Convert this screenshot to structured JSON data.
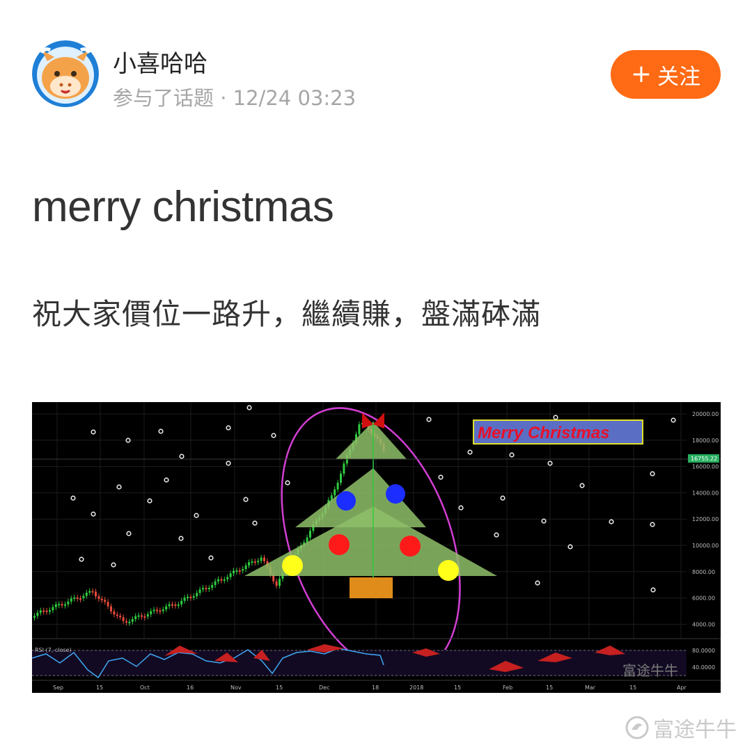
{
  "post": {
    "author": {
      "name": "小喜哈哈",
      "meta": "参与了话题 · 12/24 03:23"
    },
    "follow_button": {
      "plus": "+",
      "label": "关注"
    },
    "title": "merry christmas",
    "body": "祝大家價位一路升，繼續賺，盤滿砵滿"
  },
  "chart_image": {
    "banner_text": "Merry Christmas",
    "price_ticks": [
      "20000.00",
      "18000.00",
      "16000.00",
      "14000.00",
      "12000.00",
      "10000.00",
      "8000.00",
      "6000.00",
      "4000.00"
    ],
    "current_price_label": "16755.22",
    "rsi_label": "RSI (7, close)",
    "rsi_ticks": [
      "80.0000",
      "40.0000"
    ],
    "x_ticks": [
      "Sep",
      "15",
      "Oct",
      "16",
      "Nov",
      "15",
      "Dec",
      "18",
      "2018",
      "15",
      "Feb",
      "15",
      "Mar",
      "15",
      "Apr"
    ],
    "chart_watermark": "富途牛牛"
  },
  "watermark": {
    "text": "富途牛牛"
  },
  "colors": {
    "follow_button": "#ff6a14",
    "avatar_ring": "#1f7fd6",
    "avatar_face": "#f4a24a",
    "tree_green": "#8fbf6a",
    "ornament_red": "#ff1a1a",
    "ornament_blue": "#1b2dff",
    "ornament_yellow": "#ffff1a",
    "trunk": "#e08c1a",
    "banner_bg": "#5a6fc4",
    "banner_text": "#e8102a"
  }
}
